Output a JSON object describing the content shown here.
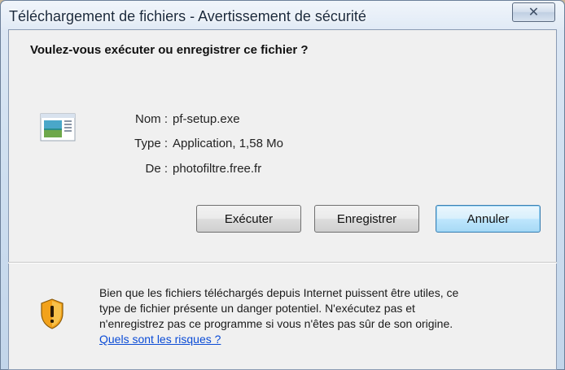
{
  "window": {
    "title": "Téléchargement de fichiers - Avertissement de sécurité",
    "close_icon": "close-icon",
    "close_glyph": "✕"
  },
  "dialog": {
    "heading": "Voulez-vous exécuter ou enregistrer ce fichier ?",
    "file_icon": "application-file-icon",
    "fields": {
      "name_label": "Nom :",
      "name_value": "pf-setup.exe",
      "type_label": "Type :",
      "type_value": "Application, 1,58 Mo",
      "from_label": "De :",
      "from_value": "photofiltre.free.fr"
    },
    "buttons": {
      "run": "Exécuter",
      "save": "Enregistrer",
      "cancel": "Annuler"
    }
  },
  "warning": {
    "icon": "security-shield-icon",
    "lines": [
      "Bien que les fichiers téléchargés depuis Internet puissent être utiles, ce",
      "type de fichier présente un danger potentiel. N'exécutez pas et",
      "n'enregistrez pas ce programme si vous n'êtes pas sûr de son origine."
    ],
    "link": "Quels sont les risques ?"
  },
  "colors": {
    "link": "#0a4bd6",
    "shield_orange": "#f2a21b",
    "default_button_border": "#3c7fb1"
  }
}
